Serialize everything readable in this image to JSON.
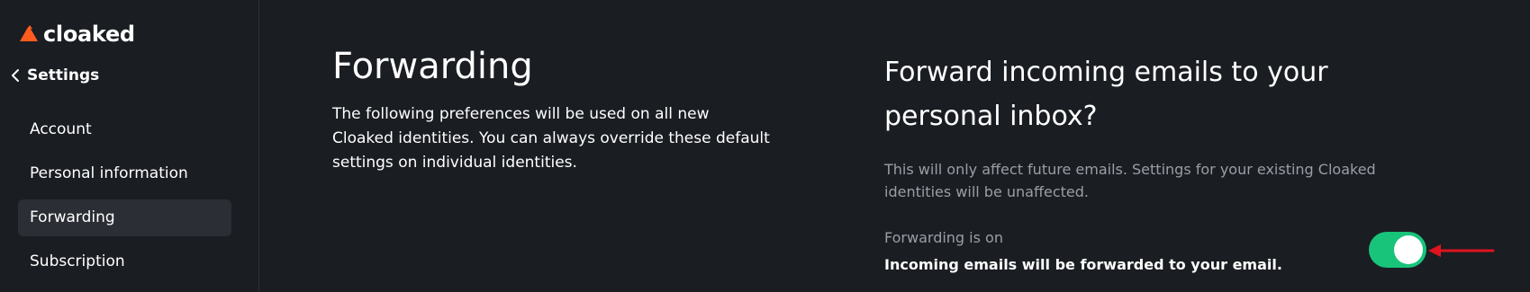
{
  "app": {
    "logo_text": "cloaked",
    "logo_icon": "cloaked-logo-icon",
    "brand_color": "#ff5b1f"
  },
  "sidebar": {
    "back_label": "Settings",
    "back_icon": "chevron-left-icon",
    "items": [
      {
        "label": "Account",
        "active": false
      },
      {
        "label": "Personal information",
        "active": false
      },
      {
        "label": "Forwarding",
        "active": true
      },
      {
        "label": "Subscription",
        "active": false
      }
    ]
  },
  "main": {
    "title": "Forwarding",
    "description": "The following preferences will be used on all new Cloaked identities. You can always override these default settings on individual identities.",
    "question_title": "Forward incoming emails to your personal inbox?",
    "question_note": "This will only affect future emails. Settings for your existing Cloaked identities will be unaffected.",
    "status_label": "Forwarding is on",
    "status_description": "Incoming emails will be forwarded to your email.",
    "toggle": {
      "state": "on",
      "color": "#18c47a"
    }
  },
  "annotation": {
    "arrow_color": "#e0141e",
    "arrow_icon": "red-arrow-annotation"
  }
}
